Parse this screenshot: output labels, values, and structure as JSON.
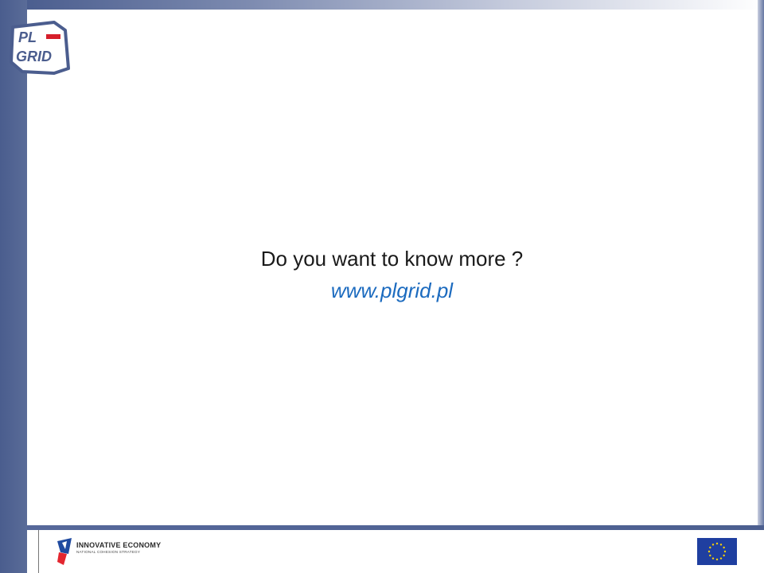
{
  "slide": {
    "question": "Do you want to know more ?",
    "link": "www.plgrid.pl"
  },
  "logo": {
    "name": "PL-Grid logo",
    "line1": "PL",
    "line2": "GRID",
    "colors": {
      "outline": "#4b5d8e",
      "fill": "#ffffff",
      "flag_red": "#d61f2b"
    }
  },
  "footer": {
    "program_title": "INNOVATIVE ECONOMY",
    "program_subtitle": "NATIONAL COHESION STRATEGY",
    "eu_flag_icon": "eu-flag-icon"
  },
  "colors": {
    "frame": "#4b5e8f",
    "link": "#1c6bbf",
    "text": "#1a1a1a",
    "eu_blue": "#1f3fa0",
    "eu_star": "#ffd200"
  }
}
